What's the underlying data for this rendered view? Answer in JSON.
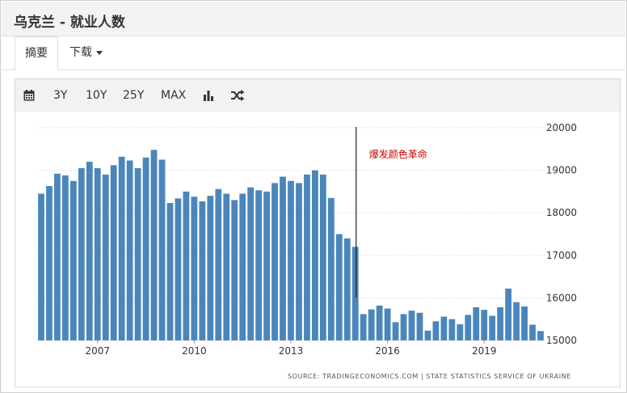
{
  "page": {
    "title": "乌克兰 - 就业人数"
  },
  "tabs": {
    "summary": "摘要",
    "download": "下载"
  },
  "toolbar": {
    "calendar_icon": "calendar-icon",
    "ranges": [
      "3Y",
      "10Y",
      "25Y",
      "MAX"
    ],
    "chart_type_icon": "bar-chart-icon",
    "random_icon": "shuffle-icon"
  },
  "colors": {
    "bar": "#4a86bb",
    "annotation": "#cc0000"
  },
  "chart_data": {
    "type": "bar",
    "title": "",
    "xlabel": "",
    "ylabel": "",
    "ylim": [
      15000,
      20000
    ],
    "y_ticks": [
      15000,
      16000,
      17000,
      18000,
      19000,
      20000
    ],
    "x_ticks": [
      "2007",
      "2010",
      "2013",
      "2016",
      "2019"
    ],
    "x_tick_bar_index": [
      7,
      19,
      31,
      43,
      55
    ],
    "values": [
      18450,
      18630,
      18920,
      18880,
      18750,
      19050,
      19200,
      19050,
      18900,
      19120,
      19320,
      19230,
      19050,
      19300,
      19480,
      19250,
      18230,
      18340,
      18500,
      18380,
      18270,
      18400,
      18560,
      18450,
      18300,
      18450,
      18600,
      18530,
      18500,
      18700,
      18850,
      18750,
      18700,
      18900,
      19000,
      18900,
      18350,
      17500,
      17400,
      17200,
      15620,
      15730,
      15820,
      15750,
      15430,
      15620,
      15700,
      15650,
      15230,
      15450,
      15560,
      15500,
      15380,
      15600,
      15780,
      15720,
      15580,
      15780,
      16220,
      15900,
      15800,
      15370,
      15220
    ],
    "annotation": {
      "text": "爆发颜色革命",
      "bar_index": 39
    },
    "source": "SOURCE: TRADINGECONOMICS.COM | STATE STATISTICS SERVICE OF UKRAINE"
  }
}
